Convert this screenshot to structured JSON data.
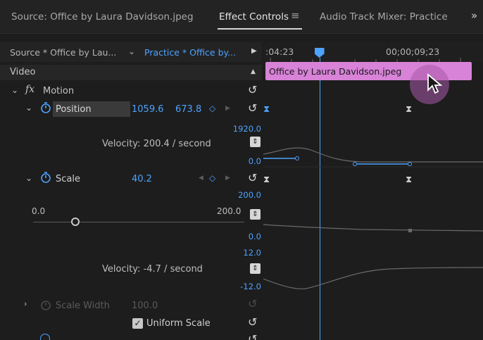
{
  "tabs": [
    {
      "label": "Source: Office by Laura Davidson.jpeg"
    },
    {
      "label": "Effect Controls"
    },
    {
      "label": "Audio Track Mixer: Practice"
    }
  ],
  "subheader": {
    "source_clip": "Source * Office by Lau...",
    "sequence_clip": "Practice * Office by...",
    "timecode_left": ":04:23",
    "timecode_right": "00;00;09;23",
    "playhead_position": 0.255
  },
  "section_label": "Video",
  "clip_name": "Office by Laura Davidson.jpeg",
  "motion": {
    "fx": "fx",
    "label": "Motion"
  },
  "position": {
    "label": "Position",
    "x": "1059.6",
    "y": "673.8",
    "graph_max": "1920.0",
    "velocity": "Velocity: 200.4 / second",
    "graph_min": "0.0"
  },
  "scale": {
    "label": "Scale",
    "value": "40.2",
    "range_max": "200.0",
    "slider_min": "0.0",
    "slider_max": "200.0",
    "slider_value": 0.201,
    "value_min": "0.0",
    "velocity_max": "12.0",
    "velocity": "Velocity: -4.7 / second",
    "velocity_min": "-12.0"
  },
  "scale_width": {
    "label": "Scale Width",
    "value": "100.0"
  },
  "uniform_scale": {
    "label": "Uniform Scale",
    "checked": true
  },
  "colors": {
    "accent": "#4da3ff",
    "clip": "#d882d8",
    "background": "#1d1d1d"
  }
}
